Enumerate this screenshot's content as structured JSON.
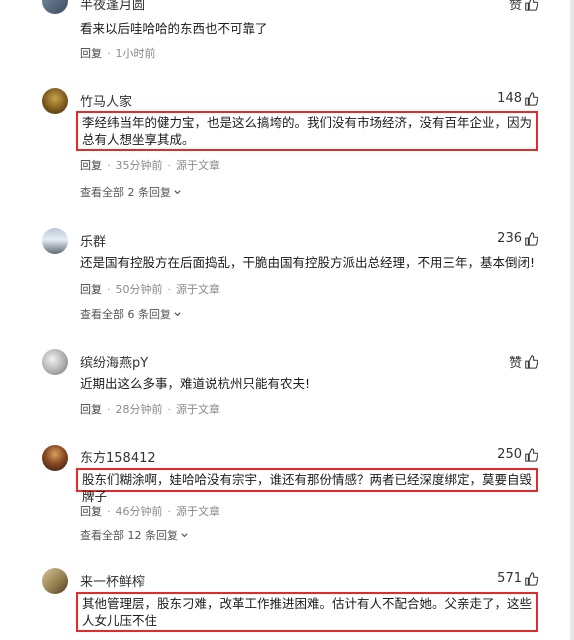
{
  "comments": [
    {
      "user": "半夜逢月圆",
      "likes": "赞",
      "content": "看来以后哇哈哈的东西也不可靠了",
      "reply": "回复",
      "time": "1小时前",
      "source": ""
    },
    {
      "user": "竹马人家",
      "likes": "148",
      "content": "李经纬当年的健力宝，也是这么搞垮的。我们没有市场经济，没有百年企业，因为总有人想坐享其成。",
      "reply": "回复",
      "time": "35分钟前",
      "source": "源于文章",
      "thread": "查看全部 2 条回复"
    },
    {
      "user": "乐群",
      "likes": "236",
      "content": "还是国有控股方在后面捣乱，干脆由国有控股方派出总经理，不用三年，基本倒闭!",
      "reply": "回复",
      "time": "50分钟前",
      "source": "源于文章",
      "thread": "查看全部 6 条回复"
    },
    {
      "user": "缤纷海燕pY",
      "likes": "赞",
      "content": "近期出这么多事，难道说杭州只能有农夫!",
      "reply": "回复",
      "time": "28分钟前",
      "source": "源于文章"
    },
    {
      "user": "东方158412",
      "likes": "250",
      "content": "股东们糊涂啊，娃哈哈没有宗宇，谁还有那份情感？两者已经深度绑定，莫要自毁牌子",
      "reply": "回复",
      "time": "46分钟前",
      "source": "源于文章",
      "thread": "查看全部 12 条回复"
    },
    {
      "user": "来一杯鲜榨",
      "likes": "571",
      "content": "其他管理层，股东刁难，改革工作推进困难。估计有人不配合她。父亲走了，这些人女儿压不住",
      "reply": "",
      "time": "",
      "source": ""
    }
  ],
  "icons": {
    "like": "thumbs-up-icon",
    "expand": "chevron-down-icon"
  },
  "colors": {
    "highlight_box": "#e32b2b"
  }
}
